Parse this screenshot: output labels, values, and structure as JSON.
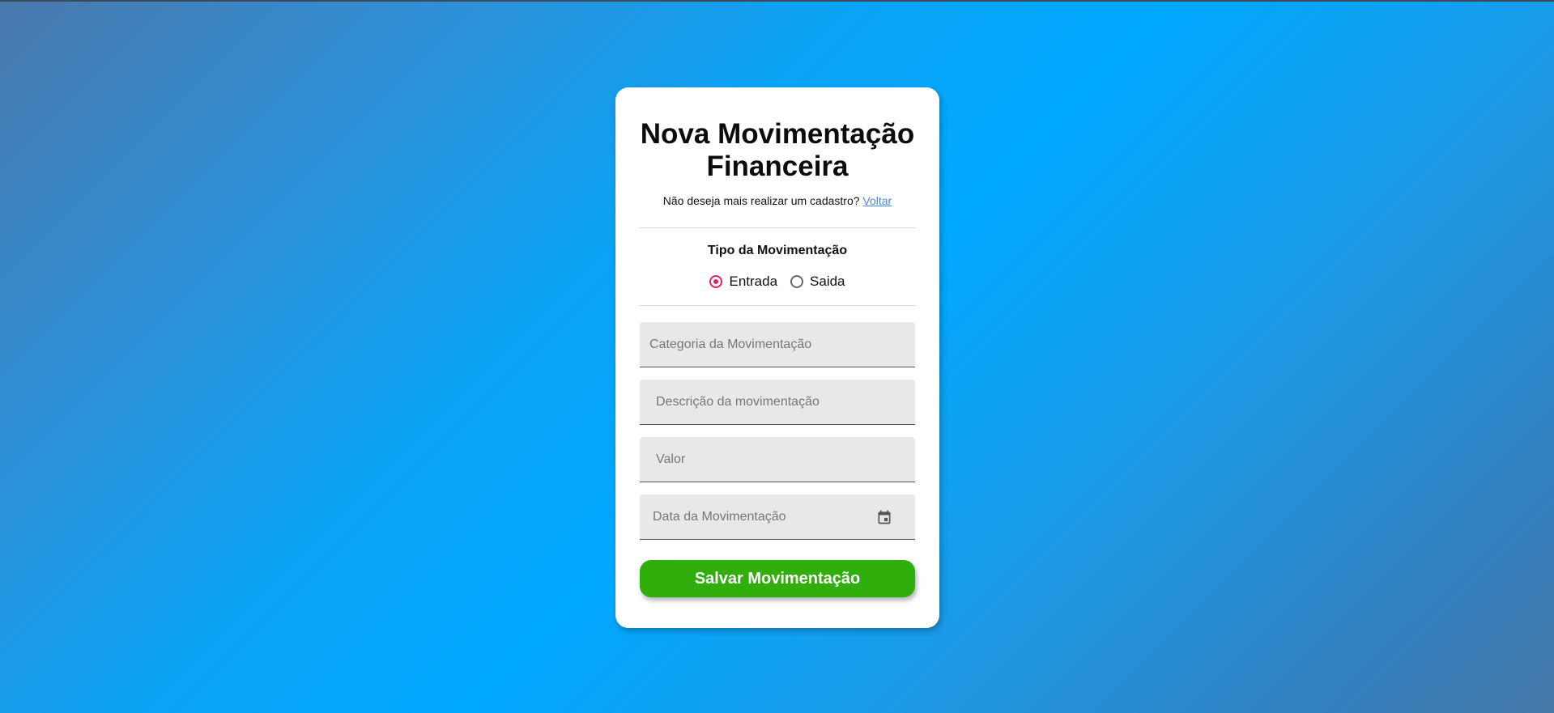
{
  "form": {
    "title": "Nova Movimentação Financeira",
    "subtitle_text": "Não deseja mais realizar um cadastro? ",
    "back_link": "Voltar",
    "type_label": "Tipo da Movimentação",
    "radio_options": [
      {
        "label": "Entrada",
        "checked": true
      },
      {
        "label": "Saida",
        "checked": false
      }
    ],
    "fields": {
      "category_placeholder": "Categoria da Movimentação",
      "description_placeholder": "Descrição da movimentação",
      "value_placeholder": "Valor",
      "date_placeholder": "Data da Movimentação"
    },
    "save_label": "Salvar Movimentação"
  },
  "colors": {
    "accent_radio": "#e0245e",
    "save_button": "#2fae0c",
    "link": "#4a86d8"
  },
  "icons": {
    "date": "calendar-icon"
  }
}
